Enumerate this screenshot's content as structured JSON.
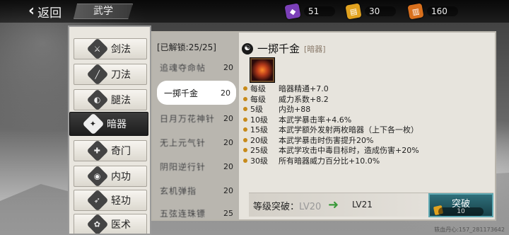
{
  "topbar": {
    "back_label": "返回",
    "tab_title": "武学",
    "currencies": [
      {
        "icon": "purple-token-icon",
        "value": "51",
        "color": "#7b3fb8"
      },
      {
        "icon": "gold-scroll-icon",
        "value": "30",
        "color": "#e1a21f"
      },
      {
        "icon": "book-icon",
        "value": "160",
        "color": "#d9701d"
      }
    ]
  },
  "categories": [
    {
      "label": "剑法",
      "icon": "sword-icon",
      "active": false
    },
    {
      "label": "刀法",
      "icon": "blade-icon",
      "active": false
    },
    {
      "label": "腿法",
      "icon": "kick-icon",
      "active": false
    },
    {
      "label": "暗器",
      "icon": "shuriken-icon",
      "active": true
    },
    {
      "label": "奇门",
      "icon": "odd-weapon-icon",
      "active": false
    },
    {
      "label": "内功",
      "icon": "inner-power-icon",
      "active": false
    },
    {
      "label": "轻功",
      "icon": "lightness-icon",
      "active": false
    },
    {
      "label": "医术",
      "icon": "medicine-icon",
      "active": false
    }
  ],
  "skill_list": {
    "unlock_text": "[已解锁:25/25]",
    "items": [
      {
        "name": "追魂夺命帖",
        "level": "20",
        "active": false
      },
      {
        "name": "一掷千金",
        "level": "20",
        "active": true
      },
      {
        "name": "日月万花神针",
        "level": "20",
        "active": false
      },
      {
        "name": "无上元气针",
        "level": "20",
        "active": false
      },
      {
        "name": "阴阳逆行针",
        "level": "20",
        "active": false
      },
      {
        "name": "玄机弹指",
        "level": "20",
        "active": false
      },
      {
        "name": "五弦连珠镖",
        "level": "25",
        "active": false
      }
    ]
  },
  "detail": {
    "name": "一掷千金",
    "type": "[暗器]",
    "effects": [
      {
        "level": "每级",
        "text": "暗器精通+7.0"
      },
      {
        "level": "每级",
        "text": "威力系数+8.2"
      },
      {
        "level": "5级",
        "text": "内劲+88"
      },
      {
        "level": "10级",
        "text": "本武学暴击率+4.6%"
      },
      {
        "level": "15级",
        "text": "本武学额外发射两枚暗器（上下各一枚）"
      },
      {
        "level": "20级",
        "text": "本武学暴击时伤害提升20%"
      },
      {
        "level": "25级",
        "text": "本武学攻击中毒目标时，造成伤害+20%"
      },
      {
        "level": "30级",
        "text": "所有暗器威力百分比+10.0%"
      }
    ]
  },
  "breakthrough": {
    "label": "等级突破：",
    "current": "LV20",
    "next": "LV21",
    "button_label": "突破",
    "cost": "10"
  },
  "watermark": "轶血丹心:157_281173642"
}
